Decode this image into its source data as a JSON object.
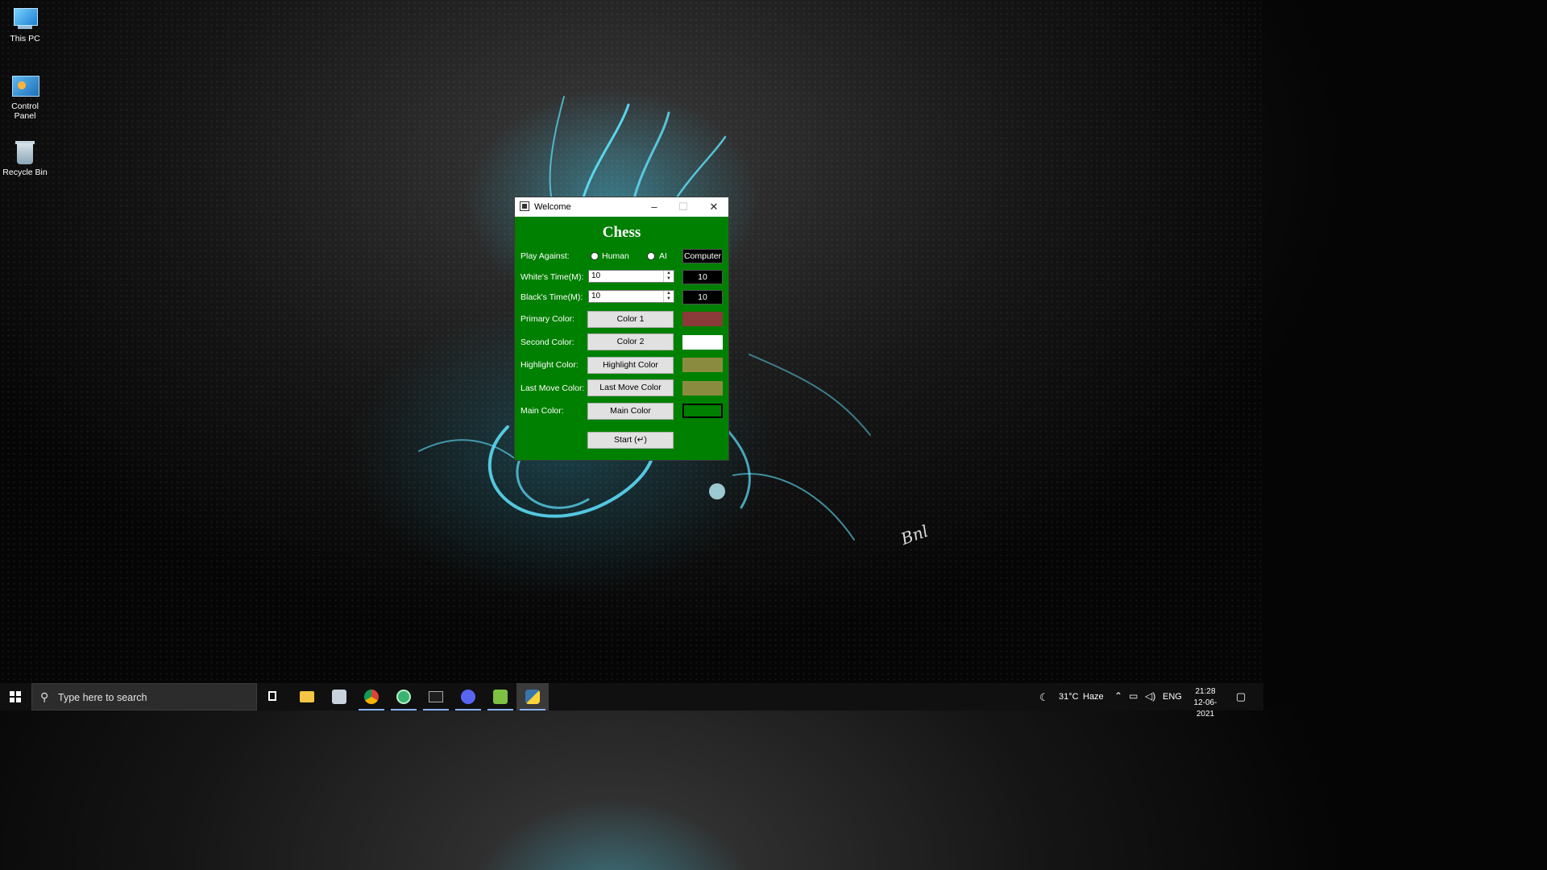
{
  "desktop": {
    "icons": [
      {
        "label": "This PC",
        "icon": "this-pc-icon"
      },
      {
        "label": "Control Panel",
        "icon": "control-panel-icon"
      },
      {
        "label": "Recycle Bin",
        "icon": "recycle-bin-icon"
      }
    ]
  },
  "window": {
    "title": "Welcome",
    "heading": "Chess",
    "background_color": "#008000",
    "play_against": {
      "label": "Play Against:",
      "options": [
        "Human",
        "AI"
      ],
      "display": "Computer"
    },
    "white_time": {
      "label": "White's Time(M):",
      "value": "10",
      "display": "10"
    },
    "black_time": {
      "label": "Black's Time(M):",
      "value": "10",
      "display": "10"
    },
    "primary_color": {
      "label": "Primary Color:",
      "button": "Color 1",
      "swatch": "#8b3a3a"
    },
    "second_color": {
      "label": "Second Color:",
      "button": "Color 2",
      "swatch": "#ffffff"
    },
    "highlight_color": {
      "label": "Highlight Color:",
      "button": "Highlight Color",
      "swatch": "#8b8b40"
    },
    "last_move_color": {
      "label": "Last Move Color:",
      "button": "Last Move Color",
      "swatch": "#8b8b40"
    },
    "main_color": {
      "label": "Main Color:",
      "button": "Main Color",
      "swatch": "#008000"
    },
    "start_button": "Start (↵)"
  },
  "taskbar": {
    "search_placeholder": "Type here to search",
    "pinned_apps": [
      "task-view-icon",
      "file-explorer-icon",
      "media-icon",
      "chrome-icon",
      "app-green-icon",
      "terminal-icon",
      "discord-icon",
      "android-icon",
      "python-icon"
    ],
    "weather": {
      "temp": "31°C",
      "condition": "Haze"
    },
    "language": "ENG",
    "time": "21:28",
    "date": "12-06-2021"
  }
}
